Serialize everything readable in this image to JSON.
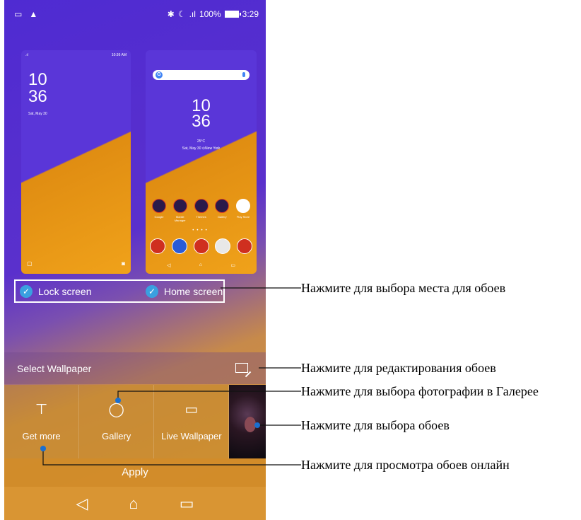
{
  "status_bar": {
    "right_text": "100%",
    "time": "3:29"
  },
  "lock_preview": {
    "status_time": "10:36 AM",
    "time_hour": "10",
    "time_min": "36",
    "date": "Sat, May 30"
  },
  "home_preview": {
    "time_hour": "10",
    "time_min": "36",
    "weather": "25°C",
    "date_loc": "Sat, May 30 ⊙New York",
    "apps": [
      "Google",
      "Mobile Manager",
      "Themes",
      "Gallery",
      "Play Store"
    ]
  },
  "targets": {
    "lock_label": "Lock screen",
    "home_label": "Home screen"
  },
  "select": {
    "label": "Select Wallpaper"
  },
  "tiles": {
    "get_more": "Get more",
    "gallery": "Gallery",
    "live": "Live Wallpaper"
  },
  "apply": {
    "label": "Apply"
  },
  "annotations": {
    "a1": "Нажмите для выбора места для обоев",
    "a2": "Нажмите для редактирования обоев",
    "a3": "Нажмите для выбора фотографии в Галерее",
    "a4": "Нажмите для выбора обоев",
    "a5": "Нажмите для просмотра обоев онлайн"
  }
}
